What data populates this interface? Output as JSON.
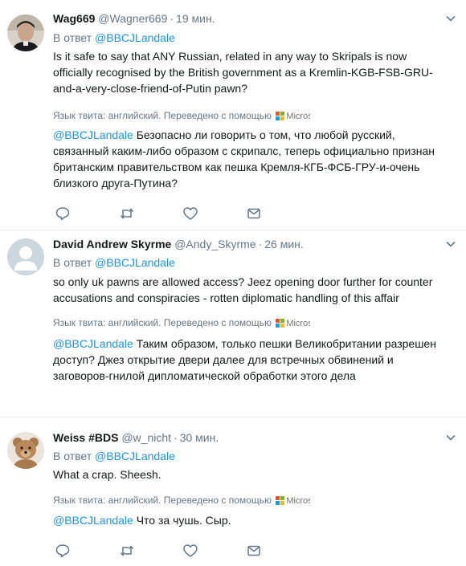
{
  "tweets": [
    {
      "display_name": "Wag669",
      "handle": "@Wagner669",
      "separator": "·",
      "time": "19 мин.",
      "reply_prefix": "В ответ",
      "reply_to": "@BBCJLandale",
      "text": "Is it safe to say that ANY Russian, related in any way to Skripals is now officially recognised by the British government as a Kremlin-KGB-FSB-GRU-and-a-very-close-friend-of-Putin pawn?",
      "lang_note": "Язык твита: английский. Переведено с помощью",
      "translator_brand": "Micros",
      "translation_mention": "@BBCJLandale",
      "translation": "Безопасно ли говорить о том, что любой русский, связанный каким-либо образом с скрипалс, теперь официально признан британским правительством как пешка Кремля-КГБ-ФСБ-ГРУ-и-очень близкого друга-Путина?",
      "avatar": "man-portrait"
    },
    {
      "display_name": "David Andrew Skyrme",
      "handle": "@Andy_Skyrme",
      "separator": "·",
      "time": "26 мин.",
      "reply_prefix": "В ответ",
      "reply_to": "@BBCJLandale",
      "text": "so only uk pawns are allowed access? Jeez opening door further for counter accusations and conspiracies - rotten diplomatic handling of this affair",
      "lang_note": "Язык твита: английский. Переведено с помощью",
      "translator_brand": "Micros",
      "translation_mention": "@BBCJLandale",
      "translation": "Таким образом, только пешки Великобритании разрешен доступ? Джез открытие двери далее для встречных обвинений и заговоров-гнилой дипломатической обработки этого дела",
      "avatar": "default-avatar"
    },
    {
      "display_name": "Weiss #BDS",
      "handle": "@w_nicht",
      "separator": "·",
      "time": "30 мин.",
      "reply_prefix": "В ответ",
      "reply_to": "@BBCJLandale",
      "text": "What a crap. Sheesh.",
      "lang_note": "Язык твита: английский. Переведено с помощью",
      "translator_brand": "Micros",
      "translation_mention": "@BBCJLandale",
      "translation": "Что за чушь. Сыр.",
      "avatar": "teddy-bear"
    }
  ],
  "colors": {
    "link": "#1b95e0",
    "muted": "#657786",
    "text": "#14171a",
    "divider": "#e6ecf0"
  },
  "icons": [
    "chevron-down-icon",
    "reply-icon",
    "retweet-icon",
    "like-icon",
    "direct-message-icon",
    "microsoft-logo-icon"
  ]
}
